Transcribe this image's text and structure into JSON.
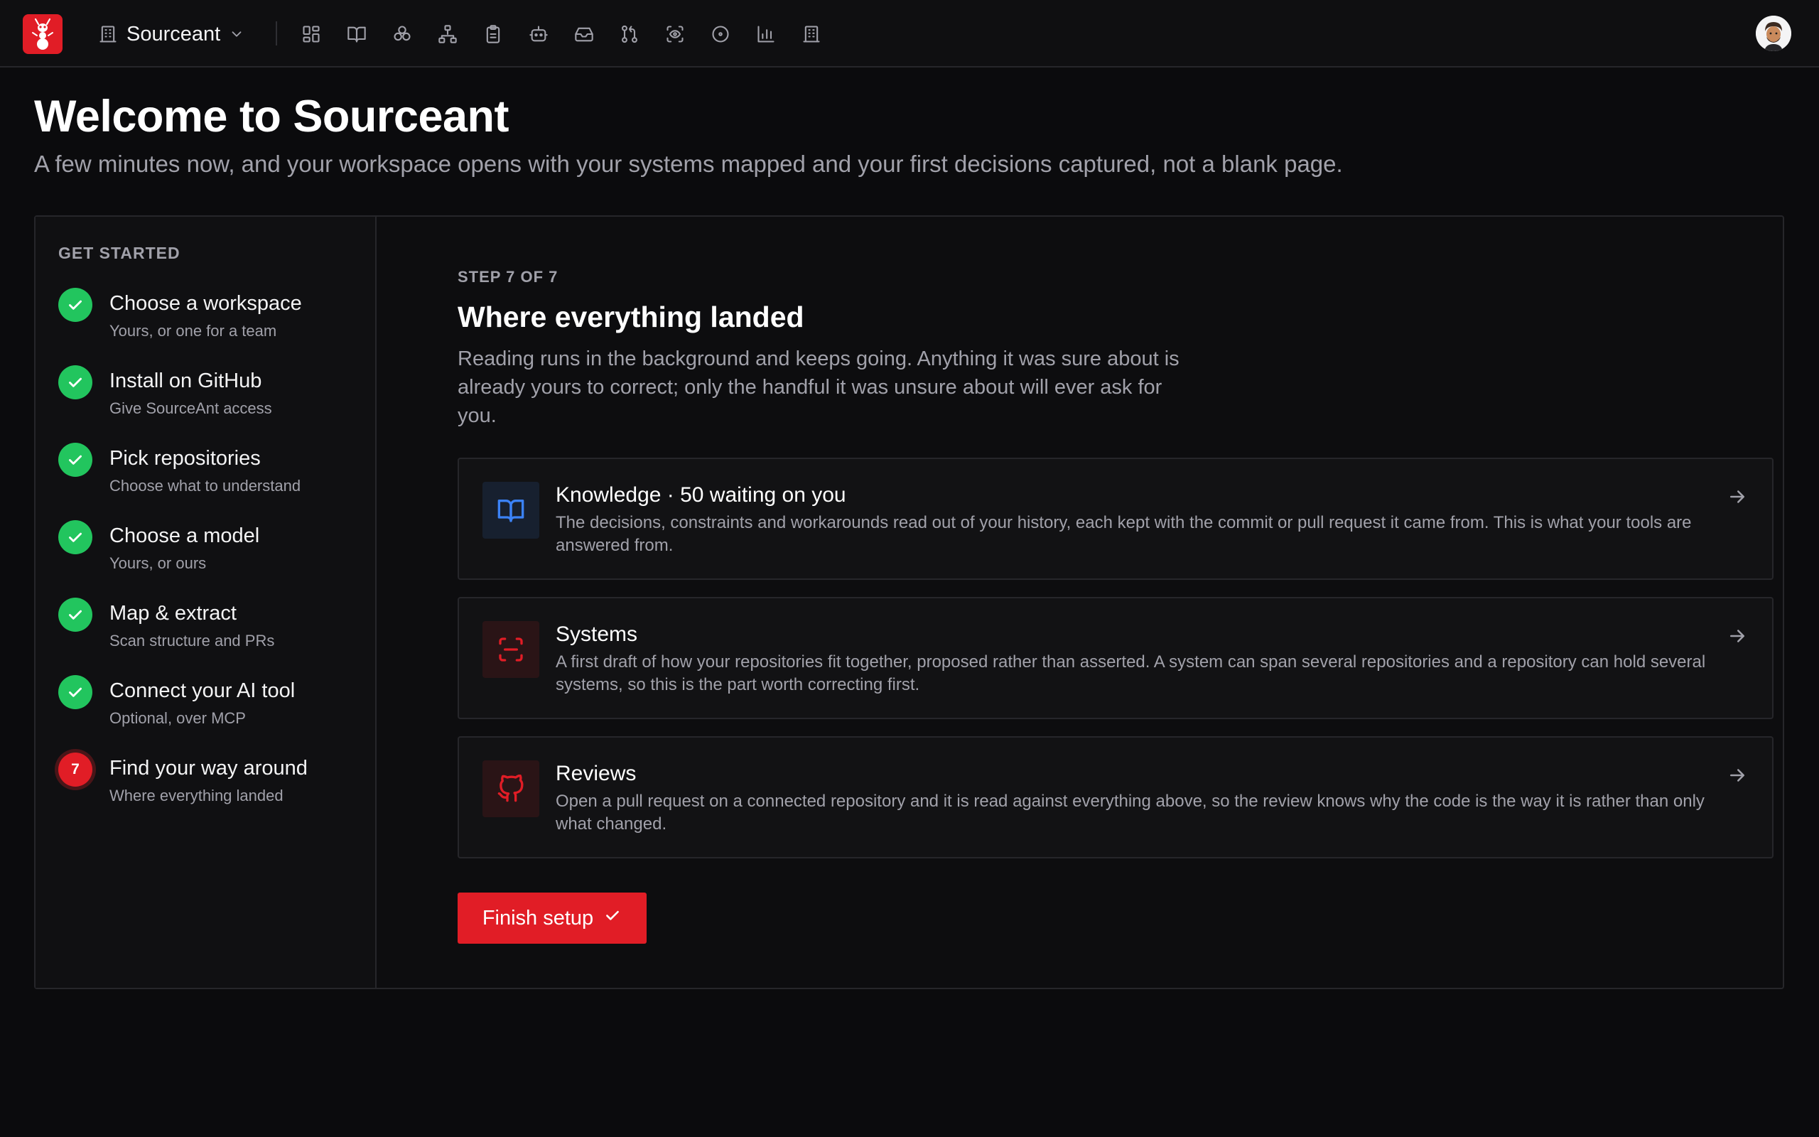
{
  "colors": {
    "background": "#0b0b0d",
    "brand": "#e11d26",
    "success": "#22c55e",
    "knowledge_accent": "#3b82f6",
    "muted_text": "#a1a1aa"
  },
  "topbar": {
    "logo_icon": "ant-logo-icon",
    "workspace_name": "Sourceant",
    "workspace_icon": "building-icon",
    "dropdown_icon": "chevron-down-icon",
    "nav_icons": [
      "dashboard-icon",
      "book-icon",
      "components-icon",
      "sitemap-icon",
      "clipboard-icon",
      "robot-icon",
      "inbox-icon",
      "git-pull-request-icon",
      "scan-eye-icon",
      "circle-dot-icon",
      "bar-chart-icon",
      "building-icon"
    ],
    "avatar_icon": "user-avatar"
  },
  "header": {
    "title": "Welcome to Sourceant",
    "subtitle": "A few minutes now, and your workspace opens with your systems mapped and your first decisions captured, not a blank page."
  },
  "sidebar": {
    "heading": "GET STARTED",
    "steps": [
      {
        "title": "Choose a workspace",
        "subtitle": "Yours, or one for a team",
        "status": "done"
      },
      {
        "title": "Install on GitHub",
        "subtitle": "Give SourceAnt access",
        "status": "done"
      },
      {
        "title": "Pick repositories",
        "subtitle": "Choose what to understand",
        "status": "done"
      },
      {
        "title": "Choose a model",
        "subtitle": "Yours, or ours",
        "status": "done"
      },
      {
        "title": "Map & extract",
        "subtitle": "Scan structure and PRs",
        "status": "done"
      },
      {
        "title": "Connect your AI tool",
        "subtitle": "Optional, over MCP",
        "status": "done"
      },
      {
        "title": "Find your way around",
        "subtitle": "Where everything landed",
        "status": "current",
        "number": "7"
      }
    ]
  },
  "main": {
    "step_label": "STEP 7 OF 7",
    "title": "Where everything landed",
    "description": "Reading runs in the background and keeps going. Anything it was sure about is already yours to correct; only the handful it was unsure about will ever ask for you.",
    "destinations": [
      {
        "icon": "book-open-icon",
        "title": "Knowledge · 50 waiting on you",
        "description": "The decisions, constraints and workarounds read out of your history, each kept with the commit or pull request it came from. This is what your tools are answered from."
      },
      {
        "icon": "scan-icon",
        "title": "Systems",
        "description": "A first draft of how your repositories fit together, proposed rather than asserted. A system can span several repositories and a repository can hold several systems, so this is the part worth correcting first."
      },
      {
        "icon": "github-icon",
        "title": "Reviews",
        "description": "Open a pull request on a connected repository and it is read against everything above, so the review knows why the code is the way it is rather than only what changed."
      }
    ],
    "finish_label": "Finish setup"
  }
}
